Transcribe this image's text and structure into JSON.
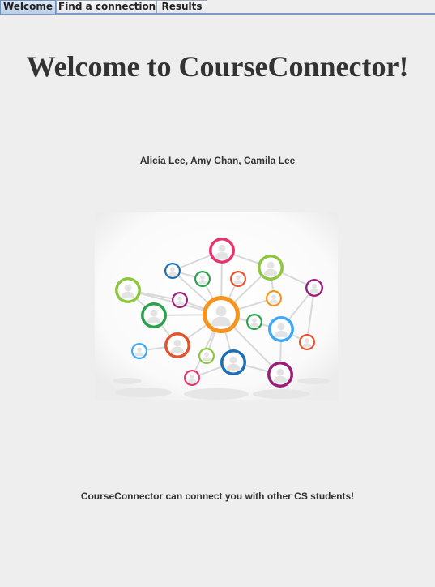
{
  "tabs": [
    {
      "label": "Welcome",
      "active": true
    },
    {
      "label": "Find a connection!",
      "active": false
    },
    {
      "label": "Results",
      "active": false
    }
  ],
  "welcome": {
    "title": "Welcome to CourseConnector!",
    "authors": "Alicia Lee, Amy Chan, Camila Lee",
    "tagline": "CourseConnector can connect you with other CS students!"
  },
  "network_graphic": {
    "icon": "people-network-illustration",
    "colors": [
      "#e8336e",
      "#1c6fb5",
      "#8dc63f",
      "#f7941d",
      "#e2542d",
      "#2aa14b",
      "#9b1f7a",
      "#3fa9f5"
    ]
  }
}
